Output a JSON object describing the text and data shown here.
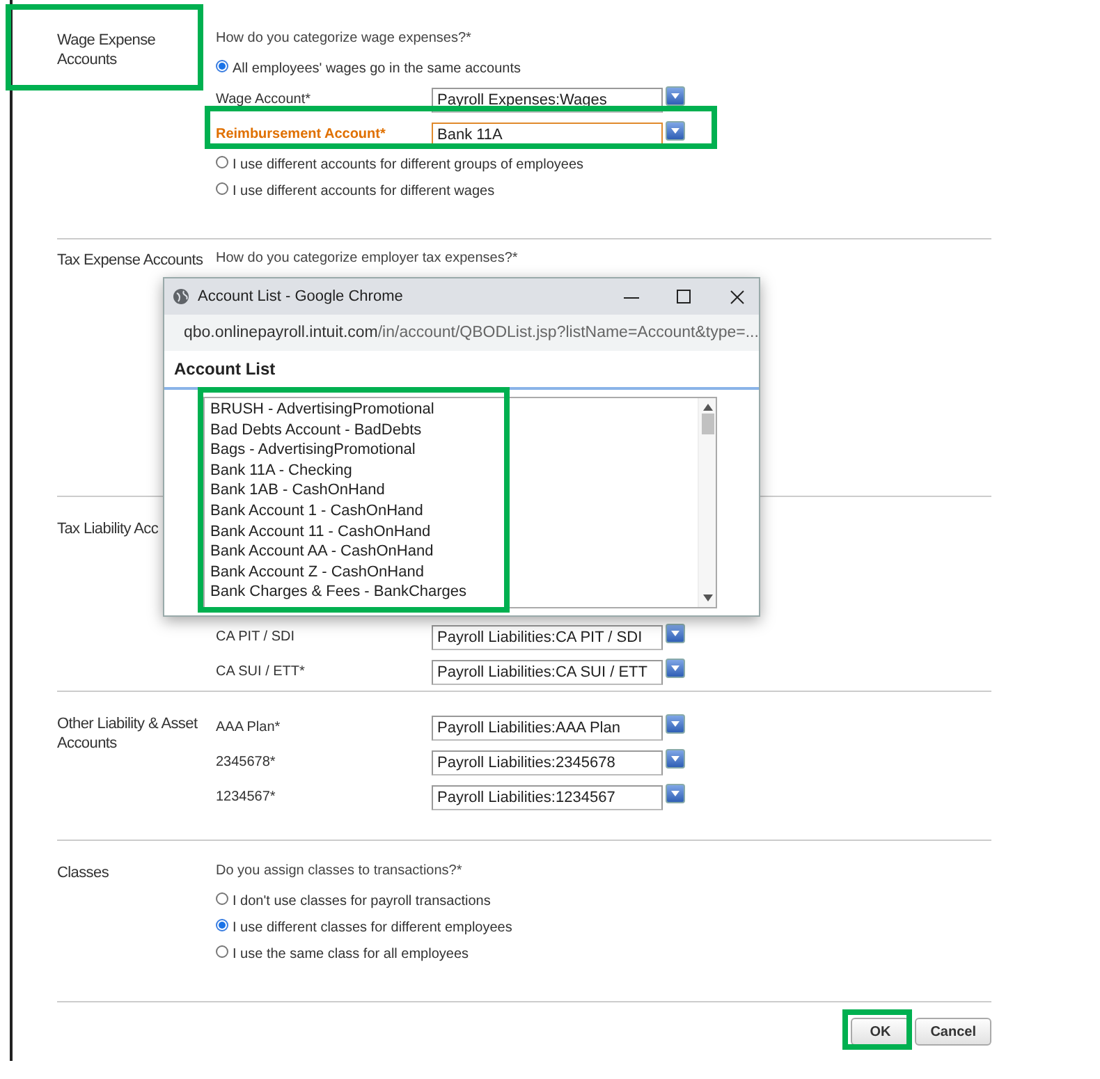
{
  "sections": [
    {
      "title": "Wage Expense Accounts",
      "highlighted": true,
      "question": "How do you categorize wage expenses?*",
      "items": [
        {
          "kind": "radio",
          "label": "All employees' wages go in the same accounts",
          "selected": true
        },
        {
          "kind": "field",
          "label": "Wage Account*",
          "value": "Payroll Expenses:Wages",
          "error": false
        },
        {
          "kind": "field",
          "label": "Reimbursement Account*",
          "value": "Bank 11A",
          "error": true,
          "highlighted": true
        },
        {
          "kind": "radio",
          "label": "I use different accounts for different groups of employees",
          "selected": false
        },
        {
          "kind": "radio",
          "label": "I use different accounts for different wages",
          "selected": false
        }
      ]
    },
    {
      "title": "Tax Expense Accounts",
      "question": "How do you categorize employer tax expenses?*"
    },
    {
      "title": "Tax Liability Acc",
      "items": [
        {
          "kind": "field",
          "label": "CA PIT / SDI",
          "value": "Payroll Liabilities:CA PIT / SDI",
          "error": false
        },
        {
          "kind": "field",
          "label": "CA SUI / ETT*",
          "value": "Payroll Liabilities:CA SUI / ETT",
          "error": false
        }
      ]
    },
    {
      "title": "Other Liability & Asset Accounts",
      "items": [
        {
          "kind": "field",
          "label": "AAA Plan*",
          "value": "Payroll Liabilities:AAA Plan",
          "error": false
        },
        {
          "kind": "field",
          "label": "2345678*",
          "value": "Payroll Liabilities:2345678",
          "error": false
        },
        {
          "kind": "field",
          "label": "1234567*",
          "value": "Payroll Liabilities:1234567",
          "error": false
        }
      ]
    },
    {
      "title": "Classes",
      "question": "Do you assign classes to transactions?*",
      "items": [
        {
          "kind": "radio",
          "label": "I don't use classes for payroll transactions",
          "selected": false
        },
        {
          "kind": "radio",
          "label": "I use different classes for different employees",
          "selected": true
        },
        {
          "kind": "radio",
          "label": "I use the same class for all employees",
          "selected": false
        }
      ]
    }
  ],
  "buttons": [
    {
      "label": "OK",
      "highlighted": true
    },
    {
      "label": "Cancel"
    }
  ],
  "popup": {
    "title": "Account List - Google Chrome",
    "url_host": "qbo.onlinepayroll.intuit.com",
    "url_path": "/in/account/QBODList.jsp?listName=Account&type=...",
    "heading": "Account List",
    "highlighted": true,
    "items": [
      "BRUSH - AdvertisingPromotional",
      "Bad Debts Account - BadDebts",
      "Bags - AdvertisingPromotional",
      "Bank 11A - Checking",
      "Bank 1AB - CashOnHand",
      "Bank Account 1 - CashOnHand",
      "Bank Account 11 - CashOnHand",
      "Bank Account AA - CashOnHand",
      "Bank Account Z - CashOnHand",
      "Bank Charges & Fees - BankCharges"
    ]
  }
}
